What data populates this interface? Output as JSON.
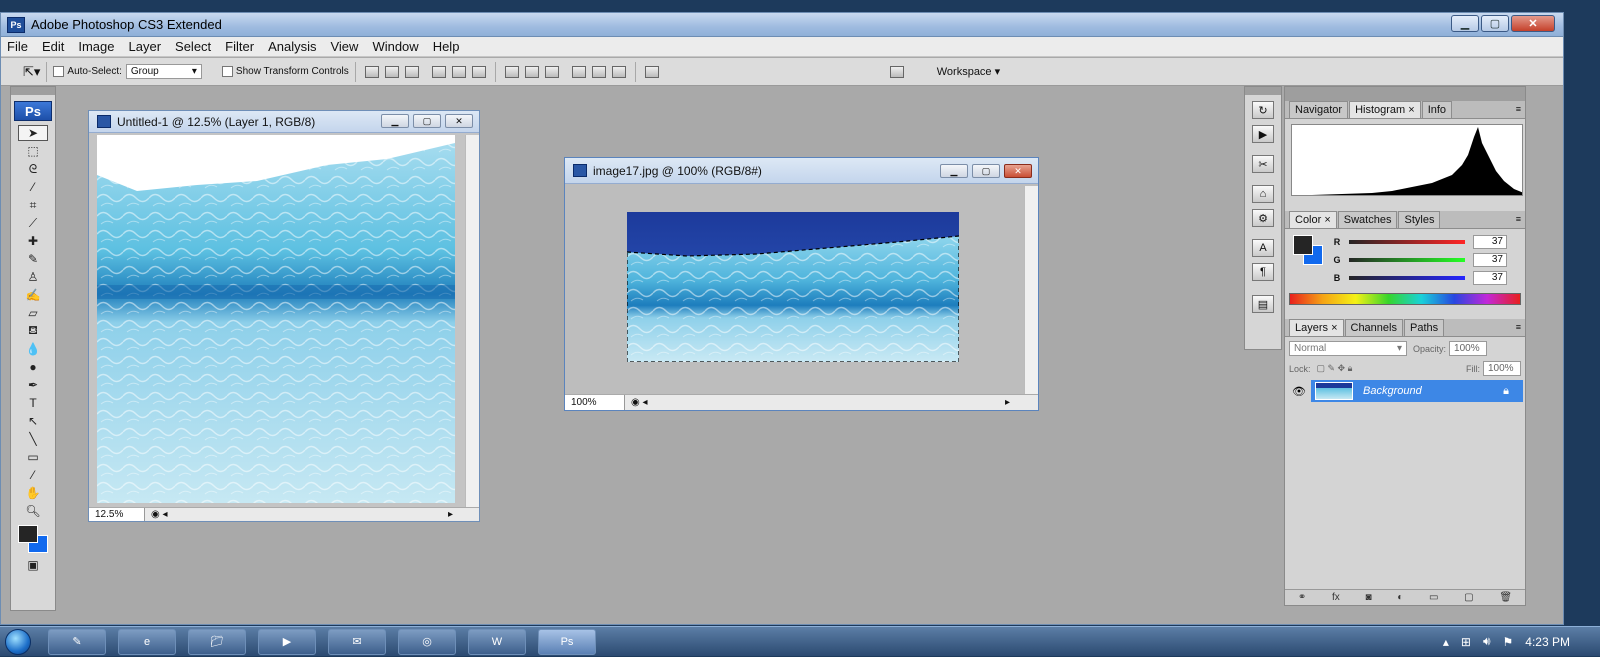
{
  "app": {
    "title": "Adobe Photoshop CS3 Extended",
    "badge": "Ps"
  },
  "menu": [
    "File",
    "Edit",
    "Image",
    "Layer",
    "Select",
    "Filter",
    "Analysis",
    "View",
    "Window",
    "Help"
  ],
  "options": {
    "auto_select_label": "Auto-Select:",
    "auto_select_value": "Group",
    "show_transform_label": "Show Transform Controls",
    "workspace_label": "Workspace ▾"
  },
  "tools": {
    "logo": "Ps",
    "icons": [
      "move-tool",
      "marquee-tool",
      "lasso-tool",
      "magic-wand-tool",
      "crop-tool",
      "slice-tool",
      "healing-tool",
      "brush-tool",
      "clone-stamp-tool",
      "history-brush-tool",
      "eraser-tool",
      "paint-bucket-tool",
      "blur-tool",
      "dodge-tool",
      "pen-tool",
      "type-tool",
      "path-select-tool",
      "line-tool",
      "notes-tool",
      "eyedropper-tool",
      "hand-tool",
      "zoom-tool"
    ]
  },
  "doc1": {
    "title": "Untitled-1 @ 12.5% (Layer 1, RGB/8)",
    "zoom": "12.5%"
  },
  "doc2": {
    "title": "image17.jpg @ 100% (RGB/8#)",
    "zoom": "100%"
  },
  "panels": {
    "nav_tabs": [
      "Navigator",
      "Histogram ×",
      "Info"
    ],
    "color_tabs": [
      "Color ×",
      "Swatches",
      "Styles"
    ],
    "color": {
      "r_label": "R",
      "g_label": "G",
      "b_label": "B",
      "r": "37",
      "g": "37",
      "b": "37",
      "fg": "#252525",
      "bg": "#1169ee"
    },
    "layer_tabs": [
      "Layers ×",
      "Channels",
      "Paths"
    ],
    "blend_mode": "Normal",
    "opacity_label": "Opacity:",
    "opacity": "100%",
    "lock_label": "Lock:",
    "fill_label": "Fill:",
    "fill": "100%",
    "layer_name": "Background"
  },
  "taskbar": {
    "active_label": "Ps",
    "time": "4:23 PM"
  }
}
